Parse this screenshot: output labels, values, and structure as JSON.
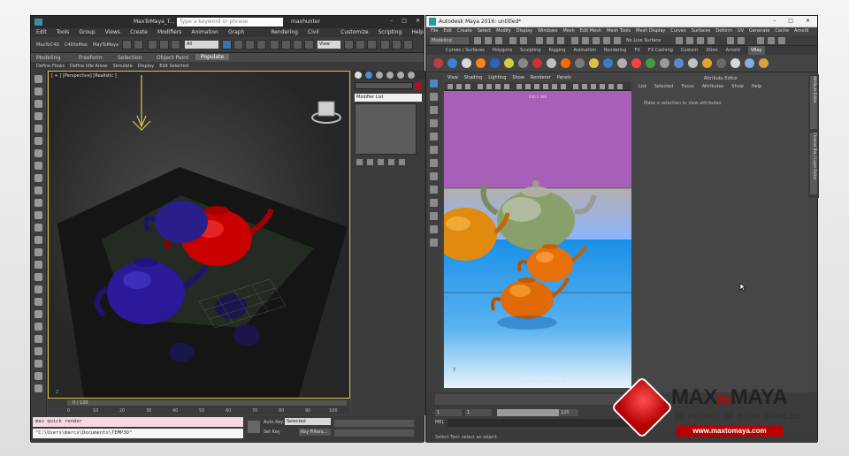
{
  "max": {
    "title": "MaxToMaya_T...",
    "search_placeholder": "Type a keyword or phrase",
    "user": "maxhunter",
    "menu": [
      "Edit",
      "Tools",
      "Group",
      "Views",
      "Create",
      "Modifiers",
      "Animation",
      "Graph Editors",
      "Rendering",
      "Civil View",
      "Customize",
      "Scripting",
      "Help"
    ],
    "toolbar": {
      "set1": "MaxToC4D",
      "set2": "C4DtoMax",
      "set3": "MayToMaya",
      "filter": "All",
      "view": "View"
    },
    "ribbon_tabs": [
      "Modeling",
      "Freeform",
      "Selection",
      "Object Paint",
      "Populate"
    ],
    "ribbon_items": [
      "Define Flows",
      "Define Idle Areas",
      "Simulate",
      "Display",
      "Edit Selected"
    ],
    "viewport_label": "[ + ] [Perspective] [Realistic ]",
    "modifier_list": "Modifier List",
    "time_slider": "0 / 100",
    "ticks": [
      "0",
      "10",
      "20",
      "30",
      "40",
      "50",
      "60",
      "70",
      "80",
      "90",
      "100"
    ],
    "listener": {
      "line1": "max quick render",
      "line2": "\"C:\\Users\\marcs\\Documents\\TEMP3D\""
    },
    "status": {
      "auto_key": "Auto Key",
      "set_key": "Set Key",
      "selected": "Selected",
      "key_filters": "Key Filters..."
    }
  },
  "maya": {
    "title": "Autodesk Maya 2016: untitled*",
    "menu": [
      "File",
      "Edit",
      "Create",
      "Select",
      "Modify",
      "Display",
      "Windows",
      "Mesh",
      "Edit Mesh",
      "Mesh Tools",
      "Mesh Display",
      "Curves",
      "Surfaces",
      "Deform",
      "UV",
      "Generate",
      "Cache",
      "Arnold"
    ],
    "mode": "Modeling",
    "live_surface": "No Live Surface",
    "shelf_tabs": [
      "Curves / Surfaces",
      "Polygons",
      "Sculpting",
      "Rigging",
      "Animation",
      "Rendering",
      "FX",
      "FX Caching",
      "Custom",
      "XGen",
      "Arnold",
      "VRay"
    ],
    "active_shelf": "VRay",
    "panel_menu": [
      "View",
      "Shading",
      "Lighting",
      "Show",
      "Renderer",
      "Panels"
    ],
    "resolution": "640 x 480",
    "camera": "VRayPhysicalCamera1",
    "attribute_editor": {
      "title": "Attribute Editor",
      "menu": [
        "List",
        "Selected",
        "Focus",
        "Attributes",
        "Show",
        "Help"
      ],
      "hint": "Make a selection to view attributes"
    },
    "side_tabs": [
      "Attribute Editor",
      "Channel Box / Layer Editor"
    ],
    "range": {
      "start": "1",
      "start2": "1",
      "end": "120"
    },
    "mel": "MEL",
    "help_line": "Select Tool: select an object"
  },
  "badge": {
    "brand_a": "MAX",
    "brand_b": "to",
    "brand_c": "MAYA",
    "tagline": "3D POWER OF BOTH WORLDS",
    "url": "www.maxtomaya.com"
  },
  "chart_data": null
}
